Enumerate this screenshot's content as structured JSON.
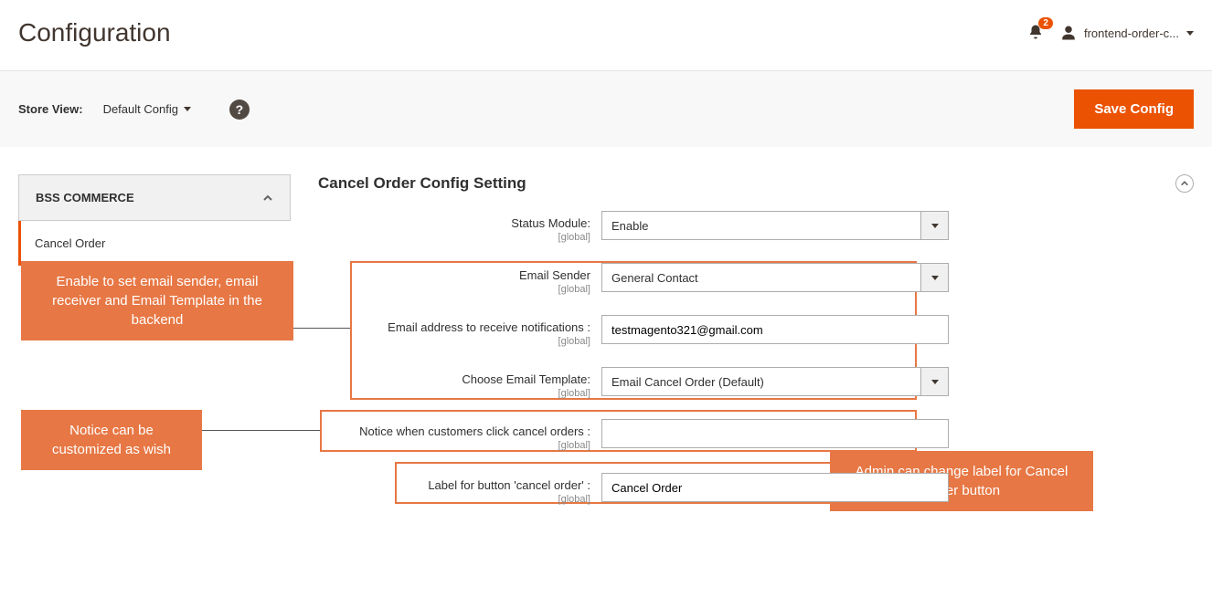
{
  "header": {
    "title": "Configuration",
    "notification_count": "2",
    "username": "frontend-order-c..."
  },
  "toolbar": {
    "store_view_label": "Store View:",
    "store_view_value": "Default Config",
    "save_label": "Save Config"
  },
  "sidebar": {
    "group_title": "BSS COMMERCE",
    "items": [
      "Cancel Order"
    ]
  },
  "section": {
    "title": "Cancel Order Config Setting"
  },
  "fields": {
    "status_module": {
      "label": "Status Module:",
      "scope": "[global]",
      "value": "Enable"
    },
    "email_sender": {
      "label": "Email Sender",
      "scope": "[global]",
      "value": "General Contact"
    },
    "email_receive": {
      "label": "Email address to receive notifications :",
      "scope": "[global]",
      "value": "testmagento321@gmail.com"
    },
    "email_template": {
      "label": "Choose Email Template:",
      "scope": "[global]",
      "value": "Email Cancel Order (Default)"
    },
    "notice": {
      "label": "Notice when customers click cancel orders :",
      "scope": "[global]",
      "value": ""
    },
    "button_label": {
      "label": "Label for button 'cancel order' :",
      "scope": "[global]",
      "value": "Cancel Order"
    }
  },
  "annotations": {
    "a1": "Enable to set email sender, email receiver and Email Template in the backend",
    "a2": "Notice can be customized as wish",
    "a3": "Admin can change label for Cancel Order button"
  }
}
